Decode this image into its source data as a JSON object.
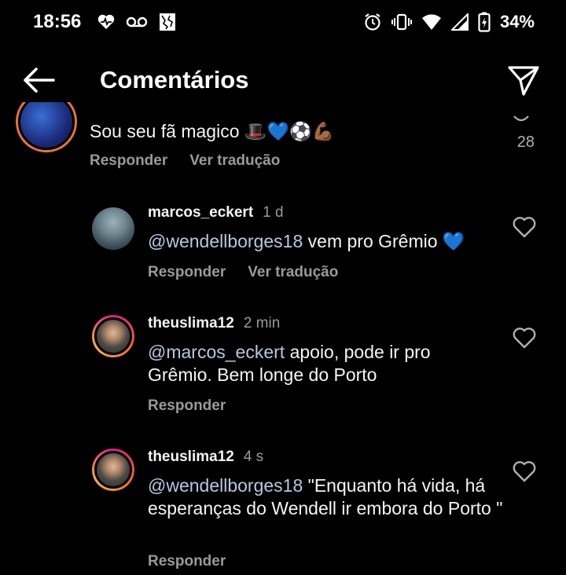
{
  "status_bar": {
    "time": "18:56",
    "battery": "34%",
    "icons": [
      "heart-pulse-icon",
      "voicemail-icon",
      "image-icon",
      "alarm-icon",
      "vibrate-icon",
      "wifi-icon",
      "signal-icon",
      "battery-charging-icon"
    ]
  },
  "header": {
    "title": "Comentários",
    "back_icon": "back-arrow-icon",
    "share_icon": "send-icon"
  },
  "top_comment": {
    "text": "Sou seu fã magico 🎩💙⚽💪🏾",
    "reply_label": "Responder",
    "translate_label": "Ver tradução",
    "like_count": "28"
  },
  "replies": [
    {
      "username": "marcos_eckert",
      "time": "1 d",
      "mention": "@wendellborges18",
      "text": " vem pro Grêmio 💙",
      "reply_label": "Responder",
      "translate_label": "Ver tradução"
    },
    {
      "username": "theuslima12",
      "time": "2 min",
      "mention": "@marcos_eckert",
      "text": " apoio, pode ir pro Grêmio. Bem longe do Porto",
      "reply_label": "Responder"
    },
    {
      "username": "theuslima12",
      "time": "4 s",
      "mention": "@wendellborges18",
      "text": " \"Enquanto há vida, há esperanças do Wendell ir embora do Porto \"",
      "reply_label": "Responder"
    }
  ],
  "colors": {
    "background": "#000000",
    "text": "#f5f5f5",
    "secondary": "#9a9a9a",
    "mention": "#b8c7e0"
  }
}
